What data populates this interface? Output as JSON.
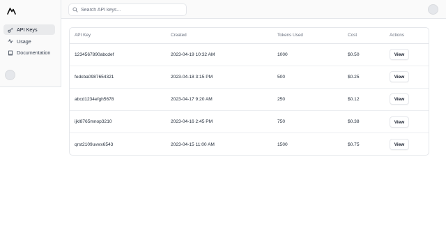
{
  "sidebar": {
    "logo_icon": "mountain-logo",
    "items": [
      {
        "label": "API Keys",
        "icon": "key-icon",
        "active": true
      },
      {
        "label": "Usage",
        "icon": "activity-icon",
        "active": false
      },
      {
        "label": "Documentation",
        "icon": "book-icon",
        "active": false
      }
    ]
  },
  "header": {
    "search": {
      "placeholder": "Search API keys...",
      "value": ""
    }
  },
  "table": {
    "columns": [
      "API Key",
      "Created",
      "Tokens Used",
      "Cost",
      "Actions"
    ],
    "rows": [
      {
        "key": "1234567890abcdef",
        "created": "2023-04-19 10:32 AM",
        "tokens": "1000",
        "cost": "$0.50",
        "action": "View"
      },
      {
        "key": "fedcba0987654321",
        "created": "2023-04-18 3:15 PM",
        "tokens": "500",
        "cost": "$0.25",
        "action": "View"
      },
      {
        "key": "abcd1234efgh5678",
        "created": "2023-04-17 9:20 AM",
        "tokens": "250",
        "cost": "$0.12",
        "action": "View"
      },
      {
        "key": "ijkl8765mnop3210",
        "created": "2023-04-16 2:45 PM",
        "tokens": "750",
        "cost": "$0.38",
        "action": "View"
      },
      {
        "key": "qrst2109uvwx6543",
        "created": "2023-04-15 11:00 AM",
        "tokens": "1500",
        "cost": "$0.75",
        "action": "View"
      }
    ]
  },
  "colors": {
    "sidebar_bg": "#fafafa",
    "active_item_bg": "#e9eaec",
    "border": "#e5e7eb"
  }
}
